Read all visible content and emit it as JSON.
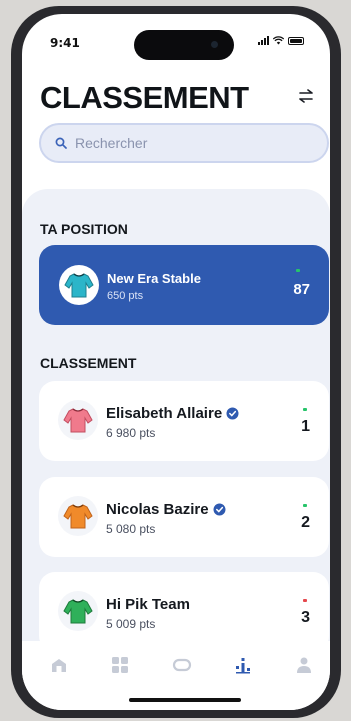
{
  "status_bar": {
    "time": "9:41"
  },
  "header": {
    "title": "CLASSEMENT",
    "filter_icon": "swap-arrows-icon"
  },
  "search": {
    "placeholder": "Rechercher",
    "icon": "search-icon"
  },
  "my_position": {
    "section_title": "TA POSITION",
    "name": "New Era Stable",
    "points": "650 pts",
    "rank": "87",
    "trend": "up",
    "trend_color": "#27c46a",
    "card_color": "#2f5ab0",
    "jersey_color": "#2bb5c9"
  },
  "ranking": {
    "section_title": "CLASSEMENT",
    "items": [
      {
        "name": "Elisabeth Allaire",
        "points": "6 980 pts",
        "rank": "1",
        "verified": true,
        "trend": "up",
        "trend_color": "#27c46a",
        "jersey_color": "#f07a8c"
      },
      {
        "name": "Nicolas Bazire",
        "points": "5 080 pts",
        "rank": "2",
        "verified": true,
        "trend": "up",
        "trend_color": "#27c46a",
        "jersey_color": "#f08a2a"
      },
      {
        "name": "Hi Pik Team",
        "points": "5 009 pts",
        "rank": "3",
        "verified": false,
        "trend": "down",
        "trend_color": "#e5484d",
        "jersey_color": "#2fb05a"
      }
    ]
  },
  "tab_bar": {
    "tabs": [
      {
        "icon": "stable-icon",
        "active": false
      },
      {
        "icon": "grid-icon",
        "active": false
      },
      {
        "icon": "horseshoe-icon",
        "active": false
      },
      {
        "icon": "leaderboard-icon",
        "active": true
      },
      {
        "icon": "profile-icon",
        "active": false
      }
    ],
    "active_color": "#2f5ab0",
    "inactive_color": "#c6cbd6"
  },
  "colors": {
    "accent": "#2f5ab0",
    "verified": "#2f5ab0",
    "background_panel": "#eef1f8"
  }
}
